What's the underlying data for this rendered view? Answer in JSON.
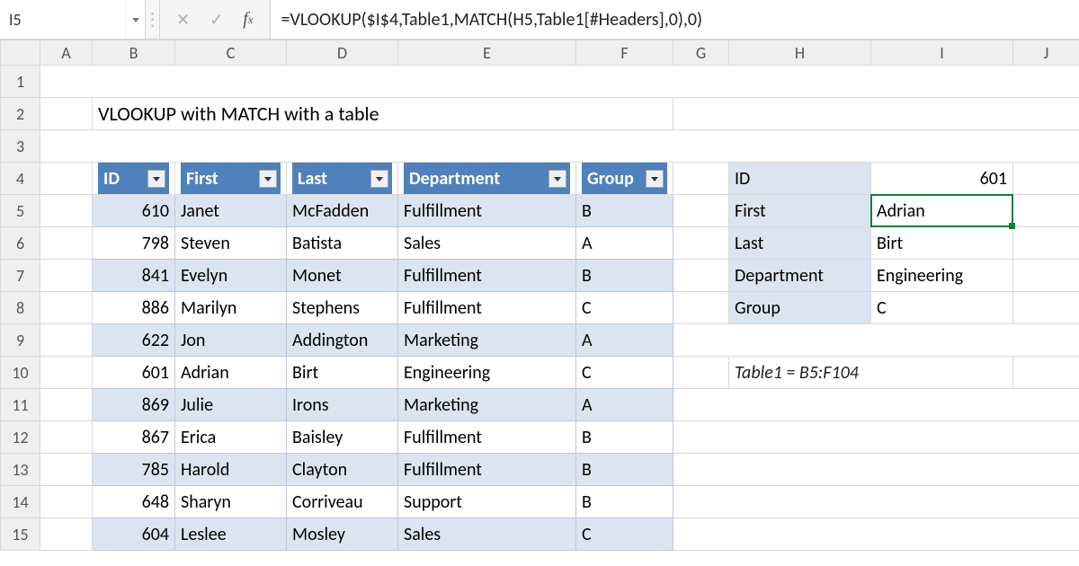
{
  "formula_bar": {
    "name_box": "I5",
    "cancel_icon": "✕",
    "confirm_icon": "✓",
    "fx_label": "fx",
    "formula": "=VLOOKUP($I$4,Table1,MATCH(H5,Table1[#Headers],0),0)"
  },
  "columns": [
    "A",
    "B",
    "C",
    "D",
    "E",
    "F",
    "G",
    "H",
    "I",
    "J"
  ],
  "title": "VLOOKUP with MATCH with a table",
  "table": {
    "headers": [
      "ID",
      "First",
      "Last",
      "Department",
      "Group"
    ],
    "rows": [
      {
        "id": "610",
        "first": "Janet",
        "last": "McFadden",
        "dept": "Fulfillment",
        "group": "B"
      },
      {
        "id": "798",
        "first": "Steven",
        "last": "Batista",
        "dept": "Sales",
        "group": "A"
      },
      {
        "id": "841",
        "first": "Evelyn",
        "last": "Monet",
        "dept": "Fulfillment",
        "group": "B"
      },
      {
        "id": "886",
        "first": "Marilyn",
        "last": "Stephens",
        "dept": "Fulfillment",
        "group": "C"
      },
      {
        "id": "622",
        "first": "Jon",
        "last": "Addington",
        "dept": "Marketing",
        "group": "A"
      },
      {
        "id": "601",
        "first": "Adrian",
        "last": "Birt",
        "dept": "Engineering",
        "group": "C"
      },
      {
        "id": "869",
        "first": "Julie",
        "last": "Irons",
        "dept": "Marketing",
        "group": "A"
      },
      {
        "id": "867",
        "first": "Erica",
        "last": "Baisley",
        "dept": "Fulfillment",
        "group": "B"
      },
      {
        "id": "785",
        "first": "Harold",
        "last": "Clayton",
        "dept": "Fulfillment",
        "group": "B"
      },
      {
        "id": "648",
        "first": "Sharyn",
        "last": "Corriveau",
        "dept": "Support",
        "group": "B"
      },
      {
        "id": "604",
        "first": "Leslee",
        "last": "Mosley",
        "dept": "Sales",
        "group": "C"
      }
    ]
  },
  "lookup": {
    "labels": {
      "id": "ID",
      "first": "First",
      "last": "Last",
      "dept": "Department",
      "group": "Group"
    },
    "values": {
      "id": "601",
      "first": "Adrian",
      "last": "Birt",
      "dept": "Engineering",
      "group": "C"
    }
  },
  "note": "Table1 = B5:F104",
  "active_cell_ref": "I5"
}
